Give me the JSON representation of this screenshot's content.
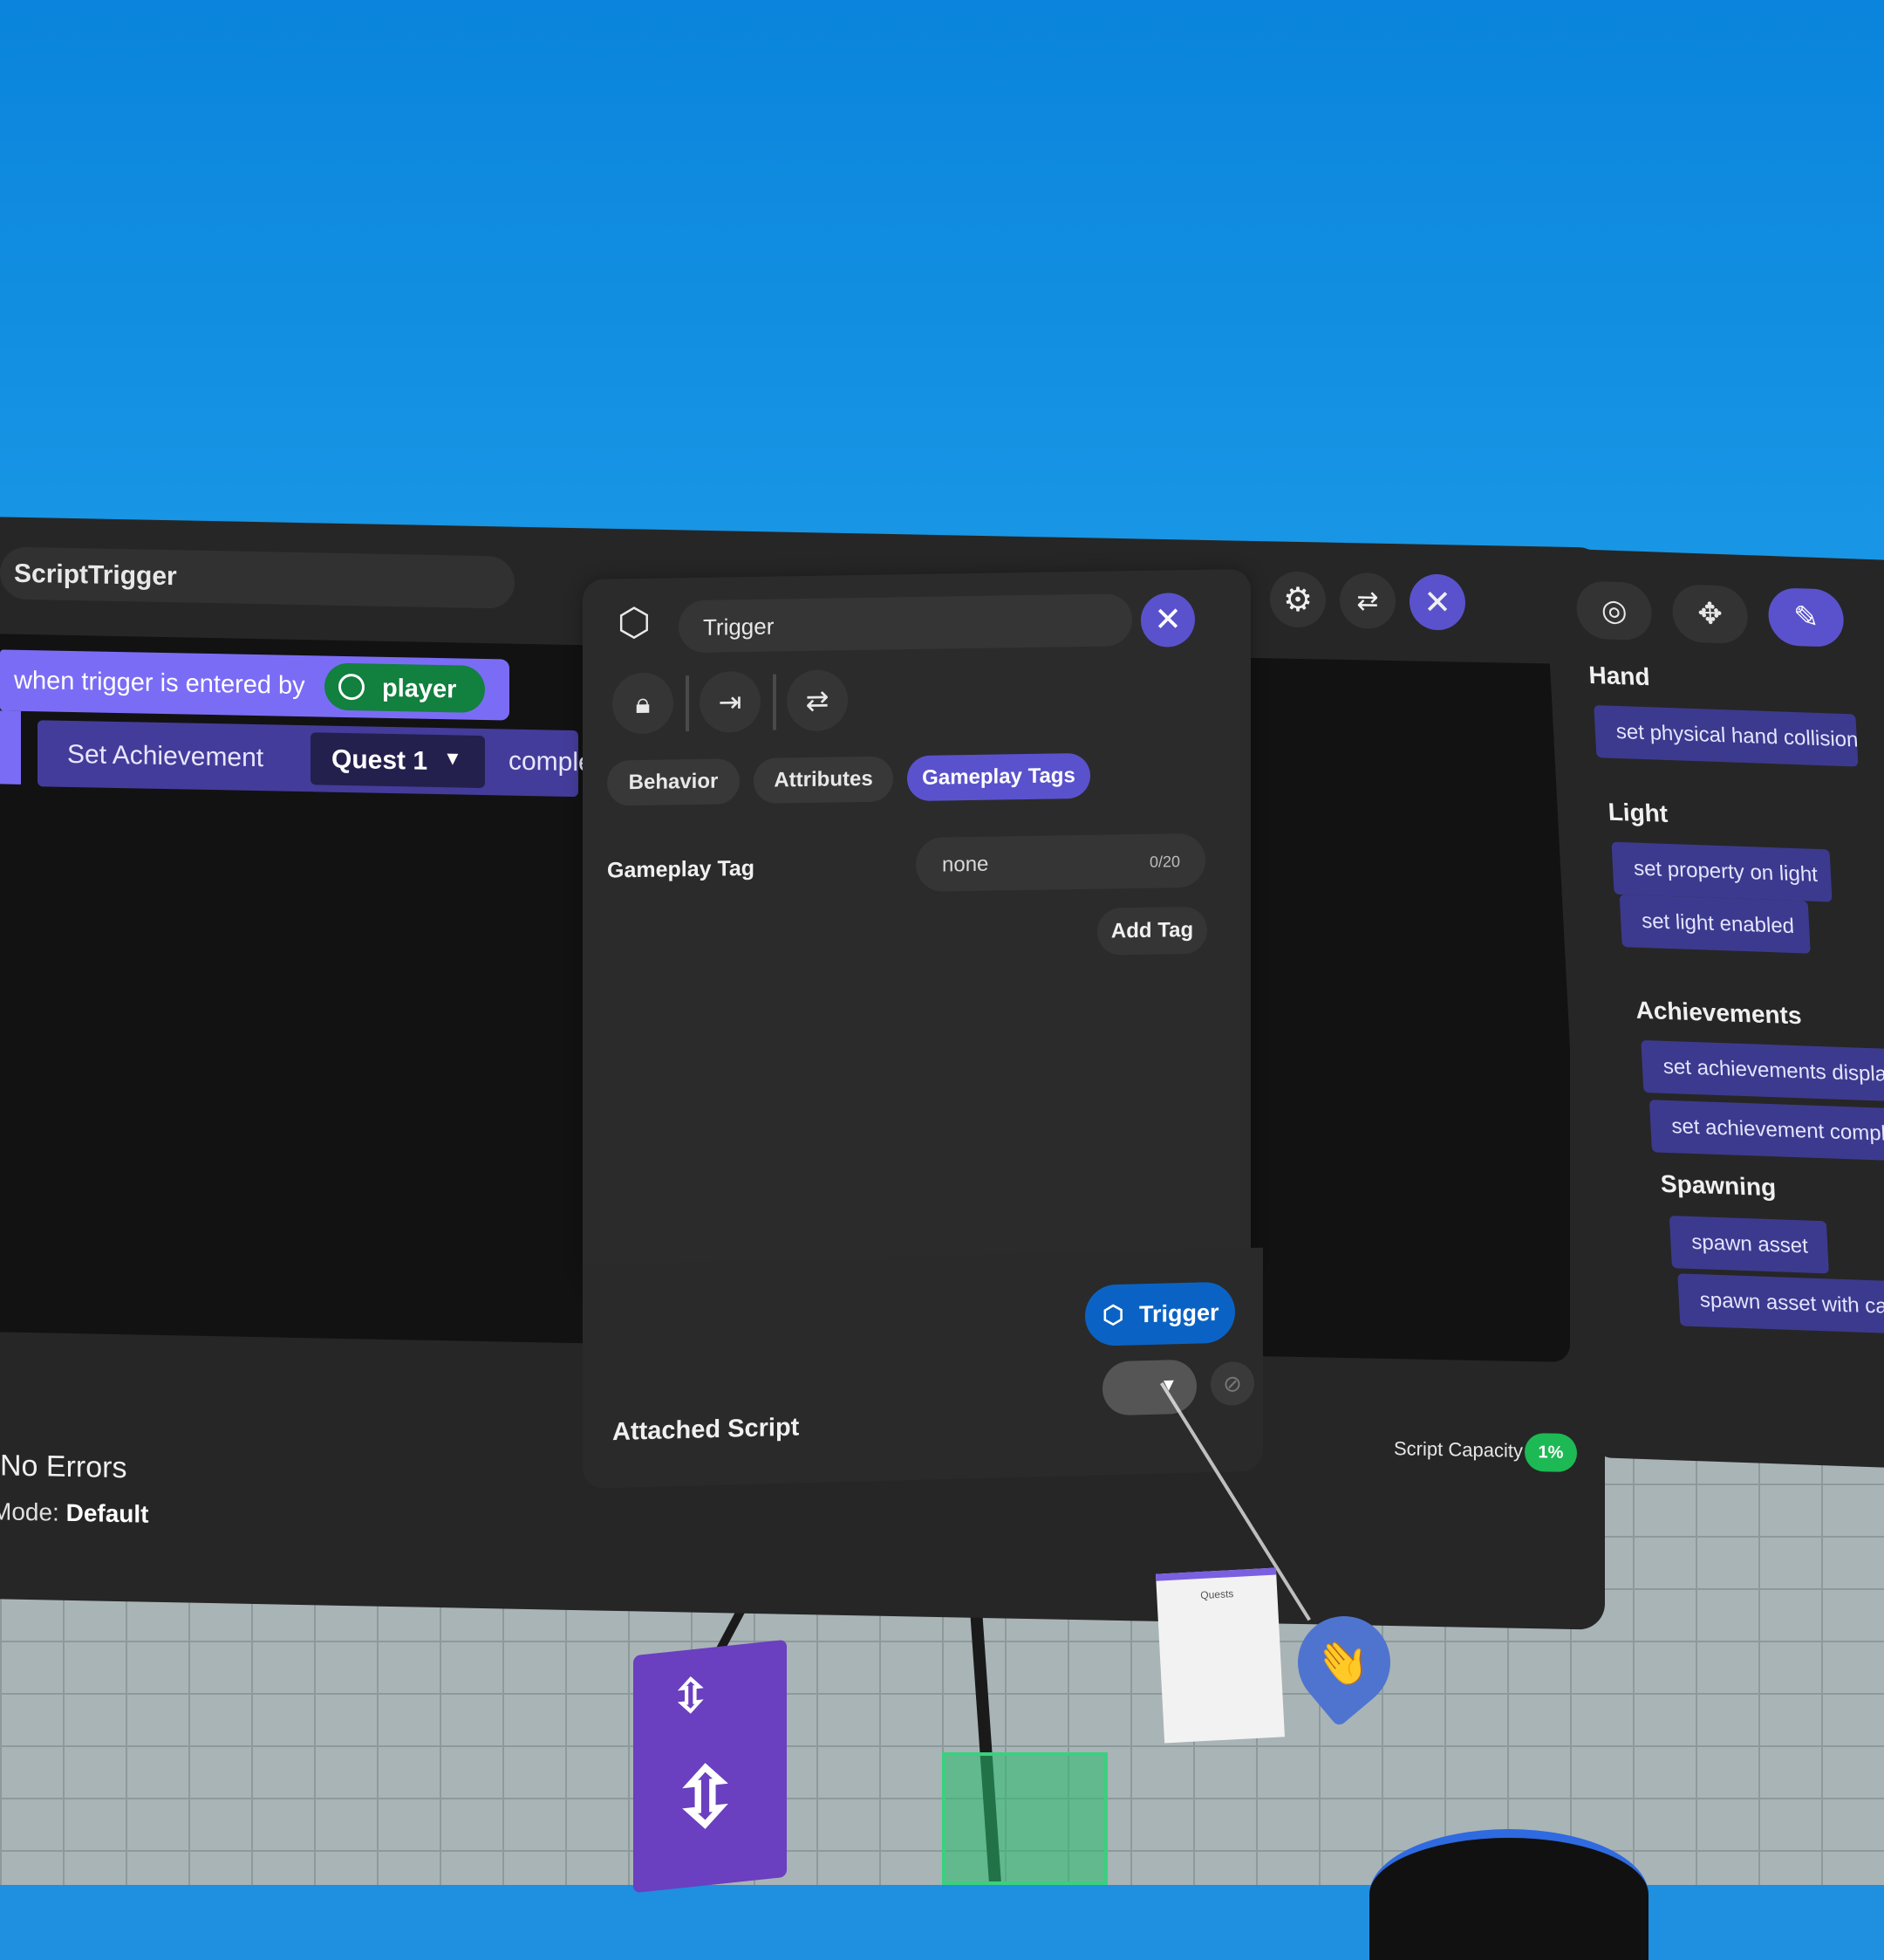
{
  "editor": {
    "script_name": "ScriptTrigger",
    "event_block": {
      "label": "when trigger is entered by",
      "target": "player"
    },
    "action_block": {
      "label": "Set Achievement",
      "quest": "Quest 1",
      "tail": "complete"
    },
    "status": "No Errors",
    "mode_label": "Mode:",
    "mode_value": "Default",
    "capacity_label": "Script Capacity",
    "capacity_value": "1%"
  },
  "props": {
    "name": "Trigger",
    "tabs": [
      "Behavior",
      "Attributes",
      "Gameplay Tags"
    ],
    "active_tab": "Gameplay Tags",
    "gameplay_tag_label": "Gameplay Tag",
    "tag_value": "none",
    "tag_count": "0/20",
    "add_tag_label": "Add Tag"
  },
  "attached": {
    "label": "Attached Script",
    "chip_label": "Trigger"
  },
  "palette": {
    "sections": [
      {
        "title": "Hand",
        "items": [
          "set physical hand collision"
        ]
      },
      {
        "title": "Light",
        "items": [
          "set property on light",
          "set light enabled"
        ]
      },
      {
        "title": "Achievements",
        "items": [
          "set achievements displayed",
          "set achievement complete"
        ]
      },
      {
        "title": "Spawning",
        "items": [
          "spawn asset",
          "spawn asset with callback"
        ]
      }
    ]
  },
  "scene": {
    "quest_card_title": "Quests"
  },
  "colors": {
    "accent": "#5a52cc",
    "event_block": "#7b6cf6",
    "action_block": "#443c9a",
    "player_pill": "#12803e",
    "capacity_badge": "#1db954",
    "trigger_chip": "#0a63c4"
  }
}
